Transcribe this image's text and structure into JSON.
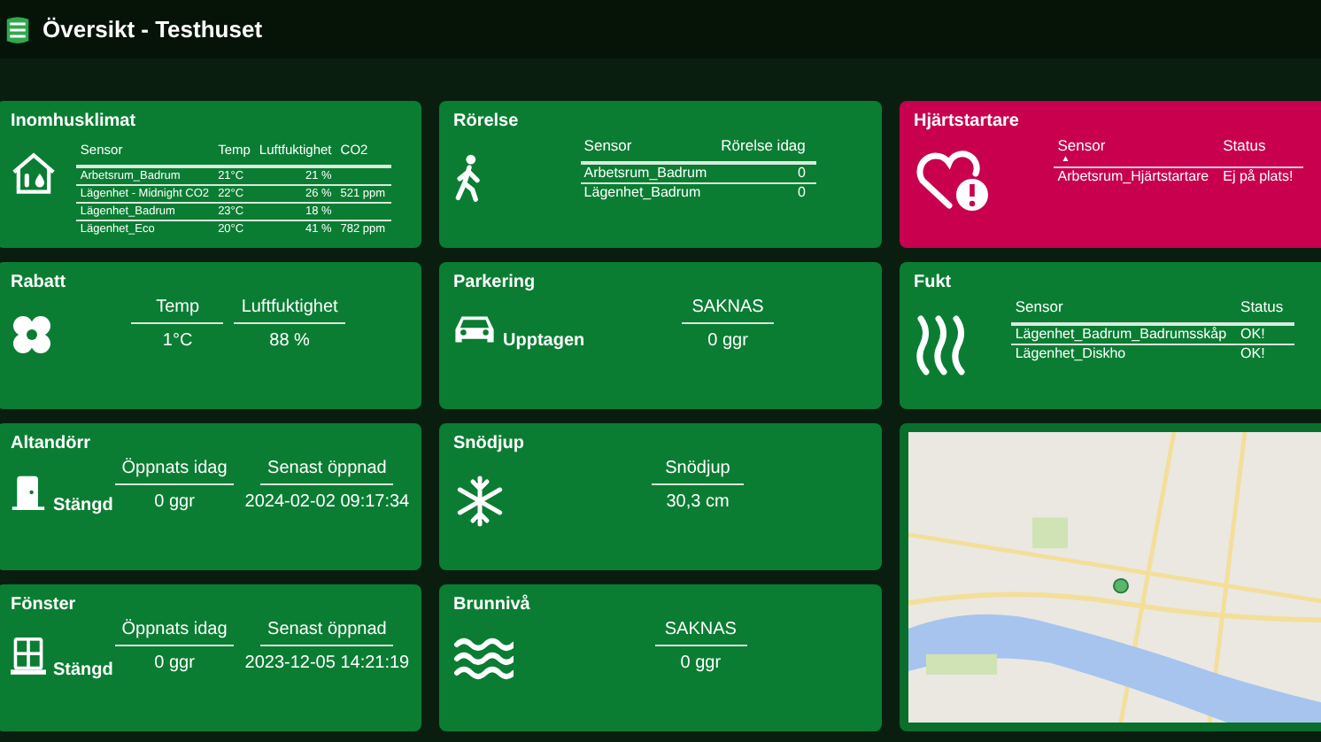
{
  "header": {
    "title": "Översikt - Testhuset"
  },
  "cards": [
    {
      "kind": "climate",
      "title": "Inomhusklimat",
      "alert": false,
      "columns": [
        "Sensor",
        "Temp",
        "Luftfuktighet",
        "CO2"
      ],
      "rows": [
        [
          "Arbetsrum_Badrum",
          "21°C",
          "21 %",
          ""
        ],
        [
          "Lägenhet - Midnight CO2",
          "22°C",
          "26 %",
          "521 ppm"
        ],
        [
          "Lägenhet_Badrum",
          "23°C",
          "18 %",
          ""
        ],
        [
          "Lägenhet_Eco",
          "20°C",
          "41 %",
          "782 ppm"
        ]
      ]
    },
    {
      "kind": "motion",
      "title": "Rörelse",
      "alert": false,
      "columns": [
        "Sensor",
        "Rörelse idag"
      ],
      "rows": [
        [
          "Arbetsrum_Badrum",
          "0"
        ],
        [
          "Lägenhet_Badrum",
          "0"
        ]
      ]
    },
    {
      "kind": "defibrillator",
      "title": "Hjärtstartare",
      "alert": true,
      "sort_mark": "▲",
      "columns": [
        "Sensor",
        "Status"
      ],
      "rows": [
        [
          "Arbetsrum_Hjärtstartare",
          "Ej på plats!"
        ]
      ]
    },
    {
      "kind": "garden",
      "title": "Rabatt",
      "columns": [
        "Temp",
        "Luftfuktighet"
      ],
      "values": [
        "1°C",
        "88 %"
      ]
    },
    {
      "kind": "parking",
      "title": "Parkering",
      "status": "Upptagen",
      "columns": [
        "SAKNAS"
      ],
      "values": [
        "0 ggr"
      ]
    },
    {
      "kind": "humidity",
      "title": "Fukt",
      "alert": false,
      "columns": [
        "Sensor",
        "Status"
      ],
      "rows": [
        [
          "Lägenhet_Badrum_Badrumsskåp",
          "OK!"
        ],
        [
          "Lägenhet_Diskho",
          "OK!"
        ]
      ]
    },
    {
      "kind": "door",
      "title": "Altandörr",
      "status": "Stängd",
      "columns": [
        "Öppnats idag",
        "Senast öppnad"
      ],
      "values": [
        "0 ggr",
        "2024-02-02 09:17:34"
      ]
    },
    {
      "kind": "snow",
      "title": "Snödjup",
      "columns": [
        "Snödjup"
      ],
      "values": [
        "30,3 cm"
      ]
    },
    {
      "kind": "map"
    },
    {
      "kind": "window",
      "title": "Fönster",
      "status": "Stängd",
      "columns": [
        "Öppnats idag",
        "Senast öppnad"
      ],
      "values": [
        "0 ggr",
        "2023-12-05 14:21:19"
      ]
    },
    {
      "kind": "well",
      "title": "Brunnivå",
      "columns": [
        "SAKNAS"
      ],
      "values": [
        "0 ggr"
      ]
    }
  ]
}
